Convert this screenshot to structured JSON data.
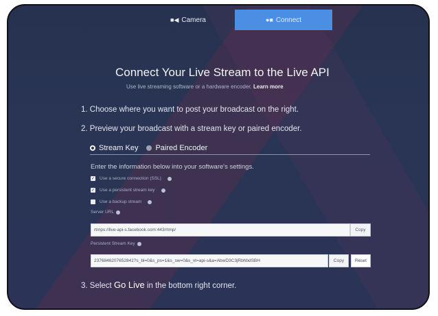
{
  "tabs": [
    {
      "label": "Camera",
      "icon": "video-camera-icon",
      "active": false
    },
    {
      "label": "Connect",
      "icon": "link-icon",
      "active": true
    }
  ],
  "header": {
    "title": "Connect Your Live Stream to the Live API",
    "subtitle": "Use live streaming software or a hardware encoder.",
    "learn_more": "Learn more"
  },
  "steps": {
    "step1": "1. Choose where you want to post your broadcast on the right.",
    "step2": "2. Preview your broadcast with a stream key or paired encoder.",
    "step3_prefix": "3. Select",
    "step3_action": "Go Live",
    "step3_suffix": "in the bottom right corner."
  },
  "mode": {
    "stream_key": "Stream Key",
    "paired_encoder": "Paired Encoder",
    "selected": "Stream Key"
  },
  "settings": {
    "info": "Enter the information below into your software's settings.",
    "options": [
      {
        "label": "Use a secure connection (SSL)",
        "checked": true
      },
      {
        "label": "Use a persistent stream key",
        "checked": true
      },
      {
        "label": "Use a backup stream",
        "checked": false
      }
    ]
  },
  "server_url": {
    "label": "Server URL",
    "value": "rtmps://live-api-s.facebook.com:443/rtmp/",
    "copy": "Copy"
  },
  "stream_key": {
    "label": "Persistent Stream Key",
    "value": "2376846207652841?s_bl=0&s_ps=1&s_sw=0&s_vt=api-s&a=AbwD3C3jRbhbdSBH",
    "copy": "Copy",
    "reset": "Reset"
  }
}
